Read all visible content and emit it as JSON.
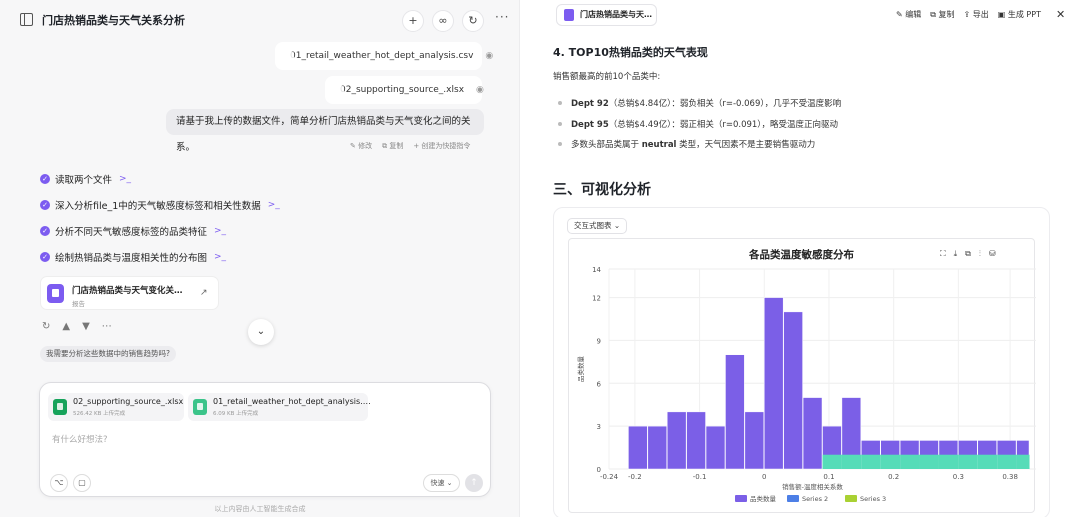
{
  "left": {
    "title": "门店热销品类与天气关系分析",
    "files": [
      {
        "name": "01_retail_weather_hot_dept_analysis.csv"
      },
      {
        "name": "02_supporting_source_.xlsx"
      }
    ],
    "user_message": "请基于我上传的数据文件，简单分析门店热销品类与天气变化之间的关系。",
    "message_actions": [
      "修改",
      "复制",
      "创建为快捷指令"
    ],
    "steps": [
      "读取两个文件",
      "深入分析file_1中的天气敏感度标签和相关性数据",
      "分析不同天气敏感度标签的品类特征",
      "绘制热销品类与温度相关性的分布图"
    ],
    "report": {
      "title": "门店热销品类与天气变化关…",
      "subtitle": "报告"
    },
    "suggestions": [
      "我需要分析这些数据中的销售趋势吗?"
    ],
    "composer": {
      "attachments": [
        {
          "name": "02_supporting_source_.xlsx",
          "meta": "526.42 KB 上传完成"
        },
        {
          "name": "01_retail_weather_hot_dept_analysis.…",
          "meta": "6.09 KB 上传完成"
        }
      ],
      "placeholder": "有什么好想法?",
      "mode": "快速"
    },
    "footer": "以上内容由人工智能生成合成"
  },
  "right": {
    "tab_title": "门店热销品类与天…",
    "tools": [
      "编辑",
      "复制",
      "导出",
      "生成 PPT"
    ],
    "section4_title": "4. TOP10热销品类的天气表现",
    "section4_intro": "销售额最高的前10个品类中:",
    "bullets": [
      {
        "bold": "Dept 92",
        "text": "（总销$4.84亿）：弱负相关（r=-0.069），几乎不受温度影响"
      },
      {
        "bold": "Dept 95",
        "text": "（总销$4.49亿）：弱正相关（r=0.091），略受温度正向驱动"
      },
      {
        "prefix": "多数头部品类属于 ",
        "bold": "neutral",
        "text": " 类型，天气因素不是主要销售驱动力"
      }
    ],
    "section3_title": "三、可视化分析",
    "chart_chip": "交互式图表"
  },
  "chart_data": {
    "type": "bar",
    "title": "各品类温度敏感度分布",
    "xlabel": "销售额-温度相关系数",
    "ylabel": "品类数量",
    "xlim": [
      -0.24,
      0.42
    ],
    "ylim": [
      0,
      14
    ],
    "xticks": [
      "-0.24",
      "-0.2",
      "-0.1",
      "0",
      "0.1",
      "0.2",
      "0.3",
      "0.38"
    ],
    "yticks": [
      0,
      3,
      6,
      9,
      12,
      14
    ],
    "bin_edges": [
      -0.21,
      -0.18,
      -0.15,
      -0.12,
      -0.09,
      -0.06,
      -0.03,
      0.0,
      0.03,
      0.06,
      0.09,
      0.12,
      0.15,
      0.18,
      0.21,
      0.24,
      0.27,
      0.3,
      0.33,
      0.36,
      0.39,
      0.41
    ],
    "series": [
      {
        "name": "品类数量",
        "color": "#7b5fe7",
        "values": [
          3,
          3,
          4,
          4,
          3,
          8,
          4,
          12,
          11,
          5,
          3,
          5,
          2,
          2,
          2,
          2,
          2,
          2,
          2,
          2,
          2
        ]
      },
      {
        "name": "Series 2",
        "color": "#4d7fe6",
        "values": [
          0,
          0,
          0,
          0,
          0,
          0,
          0,
          0,
          0,
          0,
          1,
          1,
          1,
          1,
          1,
          1,
          1,
          1,
          1,
          1,
          1
        ]
      },
      {
        "name": "Series 3",
        "color": "#a9d133",
        "values": []
      }
    ],
    "overlay_color": "#56dcb8"
  }
}
